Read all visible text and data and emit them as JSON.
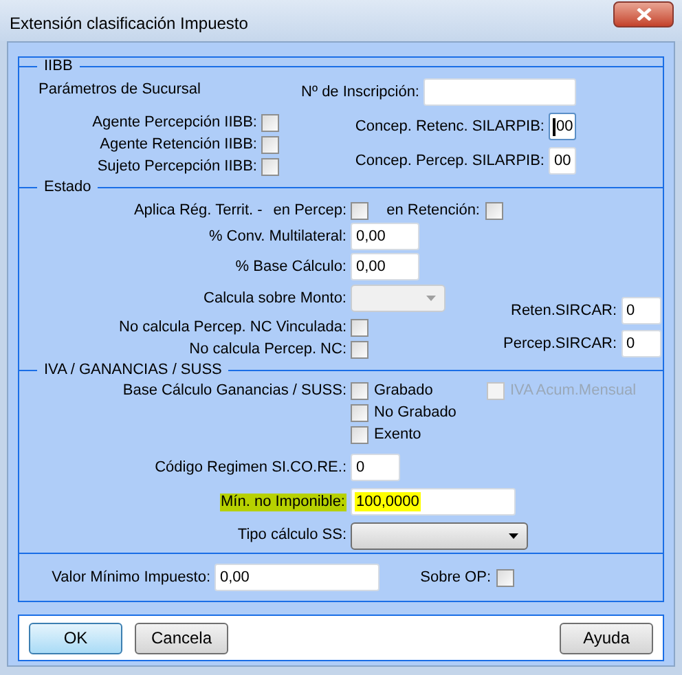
{
  "window": {
    "title": "Extensión clasificación Impuesto"
  },
  "iibb": {
    "title": "IIBB",
    "subtitle": "Parámetros de Sucursal",
    "checkboxes": [
      {
        "label": "Agente Percepción IIBB:",
        "checked": false
      },
      {
        "label": "Agente Retención IIBB:",
        "checked": false
      },
      {
        "label": "Sujeto Percepción IIBB:",
        "checked": false
      }
    ],
    "fields": [
      {
        "label": "Nº de Inscripción:",
        "focused": false
      },
      {
        "label": "Concep. Retenc. SILARPIB:",
        "value": "00",
        "focused": true
      },
      {
        "label": "Concep. Percep. SILARPIB:",
        "value": "00",
        "focused": false
      }
    ]
  },
  "estado": {
    "title": "Estado",
    "territorial": {
      "label": "Aplica Rég. Territ. -",
      "options": [
        {
          "label": "en Percep:",
          "checked": false
        },
        {
          "label": "en Retención:",
          "checked": false
        }
      ]
    },
    "fields": [
      {
        "label": "% Conv. Multilateral:",
        "value": "0,00"
      },
      {
        "label": "% Base Cálculo:",
        "value": "0,00"
      }
    ],
    "monto": {
      "label": "Calcula sobre Monto:",
      "disabled": true
    },
    "checkboxes": [
      {
        "label": "No calcula Percep. NC Vinculada:",
        "checked": false
      },
      {
        "label": "No calcula Percep. NC:",
        "checked": false
      }
    ],
    "sircar": [
      {
        "label": "Reten.SIRCAR:",
        "value": "0"
      },
      {
        "label": "Percep.SIRCAR:",
        "value": "0"
      }
    ]
  },
  "iva": {
    "title": "IVA / GANANCIAS / SUSS",
    "base_label": "Base Cálculo Ganancias / SUSS:",
    "base_options": [
      {
        "label": "Grabado",
        "checked": false
      },
      {
        "label": "No Grabado",
        "checked": false
      },
      {
        "label": "Exento",
        "checked": false
      }
    ],
    "acum": {
      "label": "IVA Acum.Mensual",
      "checked": false,
      "disabled": true
    },
    "sicore": {
      "label": "Código Regimen SI.CO.RE.:",
      "value": "0"
    },
    "minimo": {
      "label": "Mín. no Imponible:",
      "value": "100,0000",
      "highlighted": true
    },
    "tipo_ss": {
      "label": "Tipo cálculo SS:",
      "disabled": false
    }
  },
  "impuesto": {
    "label": "Valor Mínimo Impuesto:",
    "value": "0,00",
    "sobre_op": {
      "label": "Sobre OP:",
      "checked": false
    }
  },
  "buttons": [
    {
      "label": "OK",
      "default": true
    },
    {
      "label": "Cancela",
      "default": false
    },
    {
      "label": "Ayuda",
      "default": false
    }
  ]
}
